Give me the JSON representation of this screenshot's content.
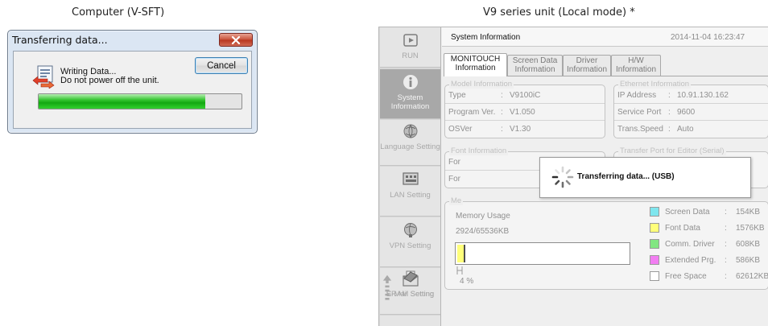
{
  "captions": {
    "left": "Computer (V-SFT)",
    "right": "V9 series unit (Local mode) *"
  },
  "dialog": {
    "title": "Transferring data...",
    "message_line1": "Writing Data...",
    "message_line2": "Do not power off the unit.",
    "cancel_label": "Cancel",
    "progress_fraction": 0.82,
    "progress_color": "#22b51f",
    "close_icon": "close-icon",
    "status_icon": "transfer-document-icon"
  },
  "unit": {
    "sidebar": [
      {
        "id": "run",
        "label": "RUN",
        "icon": "play-icon",
        "active": false
      },
      {
        "id": "system",
        "label": "System Information",
        "icon": "info-icon",
        "active": true
      },
      {
        "id": "language",
        "label": "Language Setting",
        "icon": "globe-icon",
        "active": false
      },
      {
        "id": "lan",
        "label": "LAN Setting",
        "icon": "lan-icon",
        "active": false
      },
      {
        "id": "vpn",
        "label": "VPN Setting",
        "icon": "vpn-globe-icon",
        "active": false
      },
      {
        "id": "email",
        "label": "E-Mail Setting",
        "icon": "mail-icon",
        "active": false
      },
      {
        "id": "sram",
        "label": "SRAM Setting",
        "icon": "sram-chip-icon",
        "active": false
      }
    ],
    "header": {
      "title": "System Information",
      "timestamp": "2014-11-04  16:23:47"
    },
    "tabs": [
      {
        "line1": "MONITOUCH",
        "line2": "Information",
        "active": true
      },
      {
        "line1": "Screen Data",
        "line2": "Information",
        "active": false
      },
      {
        "line1": "Driver",
        "line2": "Information",
        "active": false
      },
      {
        "line1": "H/W",
        "line2": "Information",
        "active": false
      }
    ],
    "model_info": {
      "title": "Model Information",
      "rows": [
        {
          "key": "Type",
          "colon": ":",
          "value": "V9100iC"
        },
        {
          "key": "Program Ver.",
          "colon": ":",
          "value": "V1.050"
        },
        {
          "key": "OSVer",
          "colon": ":",
          "value": "V1.30"
        }
      ]
    },
    "ethernet_info": {
      "title": "Ethernet Information",
      "rows": [
        {
          "key": "IP Address",
          "colon": ":",
          "value": "10.91.130.162"
        },
        {
          "key": "Service Port",
          "colon": ":",
          "value": "9600"
        },
        {
          "key": "Trans.Speed",
          "colon": ":",
          "value": "Auto"
        }
      ]
    },
    "font_info": {
      "title": "Font Information",
      "row1": "For",
      "row2": "For"
    },
    "transfer_port": {
      "title": "Transfer Port for Editor (Serial)"
    },
    "memory": {
      "title_visible": "Me",
      "usage_label": "Memory Usage",
      "usage_value": "2924/65536KB",
      "percent_label": "4 %",
      "usage_fraction": 0.045,
      "legend": [
        {
          "name": "Screen Data",
          "colon": ":",
          "size": "154KB",
          "color": "#7fe6ee"
        },
        {
          "name": "Font Data",
          "colon": ":",
          "size": "1576KB",
          "color": "#ffff7a"
        },
        {
          "name": "Comm. Driver",
          "colon": ":",
          "size": "608KB",
          "color": "#82e682"
        },
        {
          "name": "Extended Prg.",
          "colon": ":",
          "size": "586KB",
          "color": "#f27ef2"
        },
        {
          "name": "Free Space",
          "colon": ":",
          "size": "62612KB",
          "color": "#ffffff"
        }
      ]
    },
    "popup": {
      "text": "Transferring data... (USB)",
      "icon": "loading-spinner-icon"
    }
  }
}
